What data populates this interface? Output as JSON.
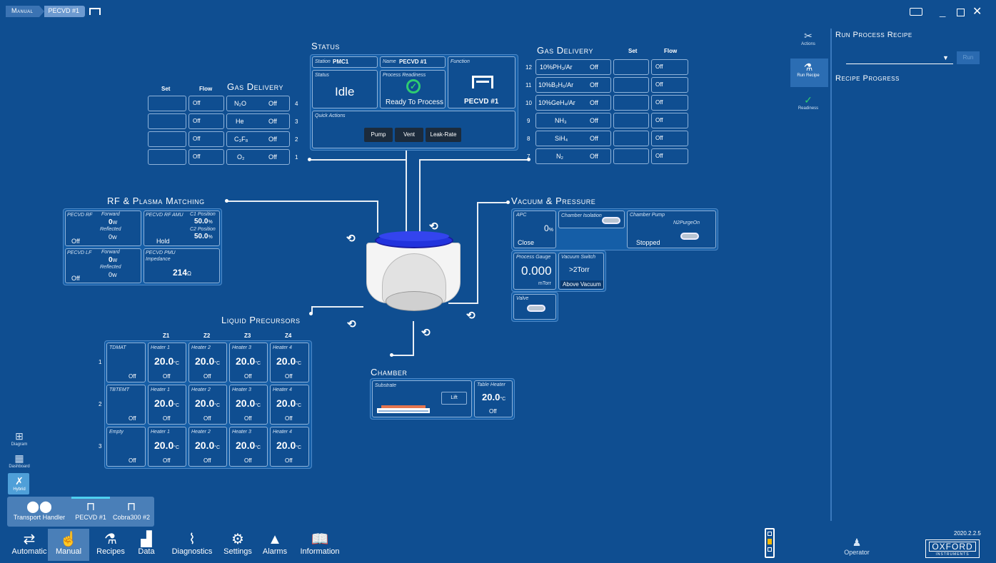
{
  "titlebar": {
    "breadcrumb": [
      "Manual",
      "PECVD #1"
    ]
  },
  "status": {
    "title": "Status",
    "station_caption": "Station",
    "station": "PMC1",
    "name_caption": "Name",
    "name": "PECVD #1",
    "function_caption": "Function",
    "function": "PECVD #1",
    "status_caption": "Status",
    "status_value": "Idle",
    "readiness_caption": "Process Readiness",
    "readiness_value": "Ready To Process",
    "quick_caption": "Quick Actions",
    "actions": [
      "Pump",
      "Vent",
      "Leak-Rate"
    ]
  },
  "gas_left": {
    "title": "Gas Delivery",
    "set_header": "Set",
    "flow_header": "Flow",
    "rows": [
      {
        "num": "4",
        "gas": "N₂O",
        "state": "Off",
        "flow": "Off",
        "set": ""
      },
      {
        "num": "3",
        "gas": "He",
        "state": "Off",
        "flow": "Off",
        "set": ""
      },
      {
        "num": "2",
        "gas": "C₃F₈",
        "state": "Off",
        "flow": "Off",
        "set": ""
      },
      {
        "num": "1",
        "gas": "O₂",
        "state": "Off",
        "flow": "Off",
        "set": ""
      }
    ]
  },
  "gas_right": {
    "title": "Gas Delivery",
    "set_header": "Set",
    "flow_header": "Flow",
    "rows": [
      {
        "num": "12",
        "gas": "10%PH₃/Ar",
        "state": "Off",
        "flow": "Off",
        "set": ""
      },
      {
        "num": "11",
        "gas": "10%B₂H₆/Ar",
        "state": "Off",
        "flow": "Off",
        "set": ""
      },
      {
        "num": "10",
        "gas": "10%GeH₄/Ar",
        "state": "Off",
        "flow": "Off",
        "set": ""
      },
      {
        "num": "9",
        "gas": "NH₃",
        "state": "Off",
        "flow": "Off",
        "set": ""
      },
      {
        "num": "8",
        "gas": "SiH₄",
        "state": "Off",
        "flow": "Off",
        "set": ""
      },
      {
        "num": "7",
        "gas": "N₂",
        "state": "Off",
        "flow": "Off",
        "set": ""
      }
    ]
  },
  "rf": {
    "title": "RF & Plasma Matching",
    "rf_caption": "PECVD RF",
    "rf_state": "Off",
    "forward_caption": "Forward",
    "reflected_caption": "Reflected",
    "rf_forward": "0",
    "rf_reflected": "0",
    "unit_w": "W",
    "amu_caption": "PECVD RF AMU",
    "c1_caption": "C1 Position",
    "c1": "50.0",
    "c2_caption": "C2 Position",
    "c2": "50.0",
    "unit_pct": "%",
    "amu_state": "Hold",
    "lf_caption": "PECVD LF",
    "lf_state": "Off",
    "lf_forward": "0",
    "lf_reflected": "0",
    "pmu_caption": "PECVD PMU",
    "impedance_caption": "Impedance",
    "impedance": "214",
    "unit_ohm": "Ω"
  },
  "vacuum": {
    "title": "Vacuum & Pressure",
    "apc_caption": "APC",
    "apc_value": "0",
    "apc_unit": "%",
    "apc_state": "Close",
    "isolation_caption": "Chamber Isolation",
    "pump_caption": "Chamber Pump",
    "purge_caption": "N2PurgeOn",
    "pump_state": "Stopped",
    "gauge_caption": "Process Gauge",
    "gauge_value": "0.000",
    "gauge_unit": "mTorr",
    "switch_caption": "Vacuum Switch",
    "switch_value": ">2Torr",
    "switch_state": "Above Vacuum",
    "valve_caption": "Valve"
  },
  "liquid": {
    "title": "Liquid Precursors",
    "zones": [
      "Z1",
      "Z2",
      "Z3",
      "Z4"
    ],
    "rows": [
      {
        "num": "1",
        "name": "TDMAT",
        "state": "Off"
      },
      {
        "num": "2",
        "name": "TBTEMT",
        "state": "Off"
      },
      {
        "num": "3",
        "name": "Empty",
        "state": "Off"
      }
    ],
    "heaters": [
      "Heater 1",
      "Heater 2",
      "Heater 3",
      "Heater 4"
    ],
    "temp": "20.0",
    "unit": "°C",
    "heater_state": "Off"
  },
  "chamber": {
    "title": "Chamber",
    "substrate_caption": "Substrate",
    "lift_label": "Lift",
    "table_caption": "Table Heater",
    "table_temp": "20.0",
    "table_unit": "°C",
    "table_state": "Off"
  },
  "right_panel": {
    "actions_label": "Actions",
    "run_recipe_label": "Run Recipe",
    "readiness_label": "Readiness",
    "run_title": "Run Process Recipe",
    "run_button": "Run",
    "progress_title": "Recipe Progress"
  },
  "views": [
    "Diagram",
    "Dashboard",
    "Hybrid"
  ],
  "modules": [
    "Transport Handler",
    "PECVD #1",
    "Cobra300 #2"
  ],
  "nav": [
    "Automatic",
    "Manual",
    "Recipes",
    "Data",
    "Diagnostics",
    "Settings",
    "Alarms",
    "Information"
  ],
  "footer": {
    "operator": "Operator",
    "version": "2020.2.2.5",
    "logo_line1": "OXFORD",
    "logo_line2": "INSTRUMENTS"
  },
  "colors": {
    "background": "#0f4e91",
    "panel": "#155ea7",
    "ready": "#2ecc71",
    "chamber_lid": "#2233dd"
  },
  "icons": {
    "sync": "sync-icon",
    "check": "check-circle-icon",
    "wrench": "wrench-icon",
    "flask": "flask-icon",
    "operator": "person-icon"
  }
}
